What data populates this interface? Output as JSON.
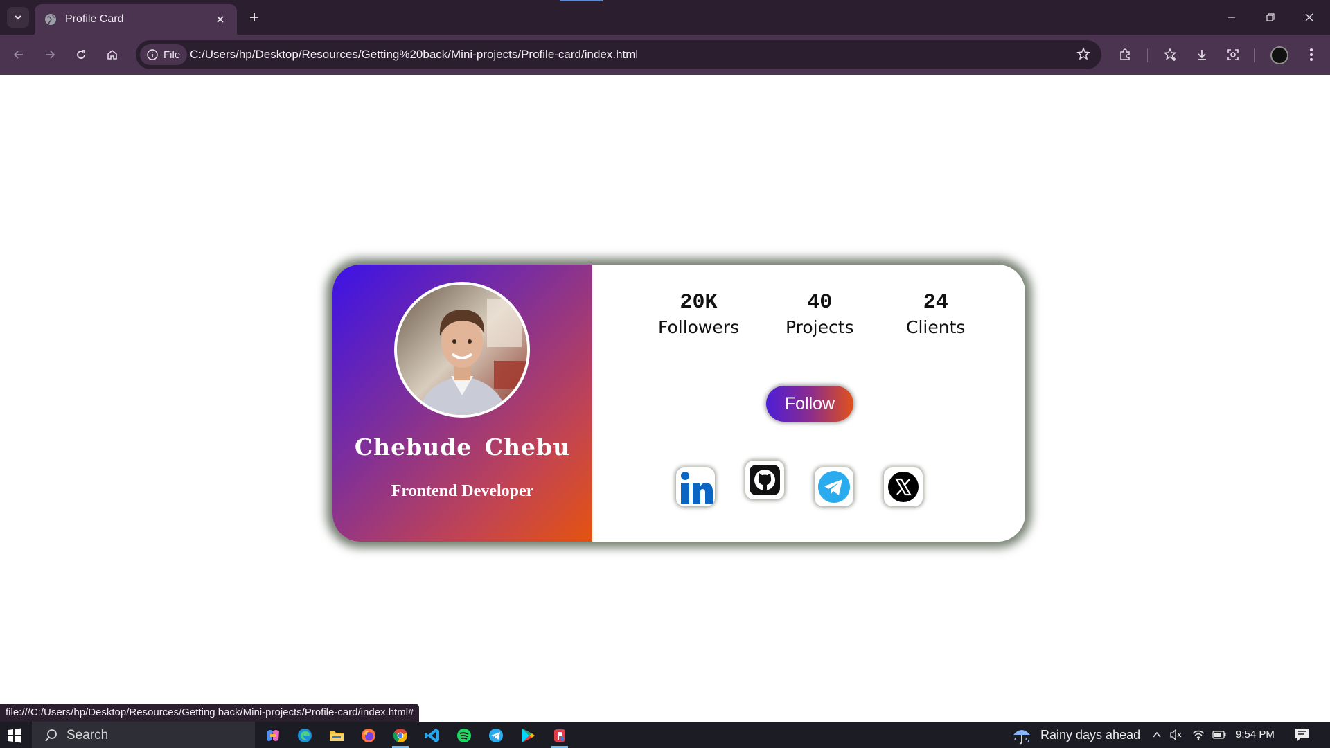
{
  "browser": {
    "tab_title": "Profile Card",
    "site_chip": "File",
    "url": "C:/Users/hp/Desktop/Resources/Getting%20back/Mini-projects/Profile-card/index.html",
    "status_url": "file:///C:/Users/hp/Desktop/Resources/Getting back/Mini-projects/Profile-card/index.html#",
    "icons": [
      "tab-list-icon",
      "globe-icon",
      "close-icon",
      "plus-icon",
      "minimize-icon",
      "restore-icon",
      "back-icon",
      "forward-icon",
      "reload-icon",
      "home-icon",
      "info-icon",
      "star-icon",
      "extensions-icon",
      "bookmarks-icon",
      "download-icon",
      "screenshot-icon",
      "profile-icon",
      "kebab-menu-icon"
    ],
    "colors": {
      "frame": "#2b1e2e",
      "toolbar": "#4a3450"
    }
  },
  "profile": {
    "name": "Chebude Chebu",
    "role": "Frontend Developer",
    "stats": [
      {
        "value": "20K",
        "label": "Followers"
      },
      {
        "value": "40",
        "label": "Projects"
      },
      {
        "value": "24",
        "label": "Clients"
      }
    ],
    "follow_label": "Follow",
    "socials": [
      "linkedin-icon",
      "github-icon",
      "telegram-icon",
      "x-icon"
    ],
    "colors": {
      "gradient_start": "#3b12e8",
      "gradient_end": "#e5530f",
      "card_shadow": "#5d6858"
    }
  },
  "taskbar": {
    "search_placeholder": "Search",
    "weather": "Rainy days ahead",
    "time": "9:54 PM",
    "apps": [
      "copilot-icon",
      "edge-icon",
      "file-explorer-icon",
      "firefox-icon",
      "chrome-icon",
      "vscode-icon",
      "spotify-icon",
      "telegram-icon",
      "play-store-icon",
      "app-icon"
    ]
  }
}
